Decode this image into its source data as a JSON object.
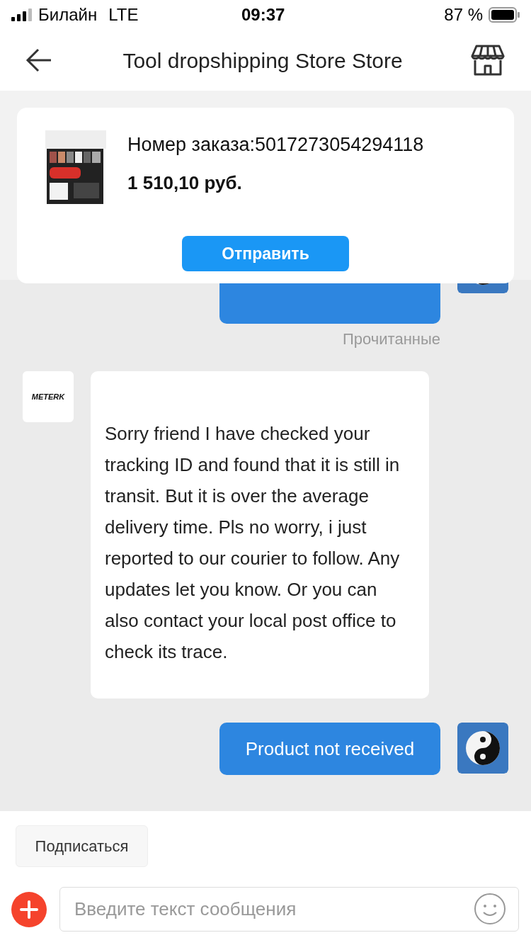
{
  "status_bar": {
    "carrier": "Билайн",
    "network": "LTE",
    "time": "09:37",
    "battery": "87 %"
  },
  "header": {
    "title": "Tool dropshipping Store Store"
  },
  "order_card": {
    "order_number": "Номер заказа:5017273054294118",
    "price": "1 510,10 руб.",
    "send_button": "Отправить"
  },
  "messages": [
    {
      "kind": "outgoing_cut"
    },
    {
      "kind": "read_status",
      "text": "Прочитанные"
    },
    {
      "kind": "incoming",
      "avatar_logo": "METERK",
      "text": "Sorry friend I have checked your tracking ID and found that it is still in transit. But it is over the average delivery time. Pls no worry, i just reported to our courier to follow. Any updates let you know. Or you can also contact your local post office to check its trace."
    },
    {
      "kind": "outgoing",
      "text": "Product not received"
    }
  ],
  "subscribe_button": "Подписаться",
  "composer": {
    "placeholder": "Введите текст сообщения"
  }
}
